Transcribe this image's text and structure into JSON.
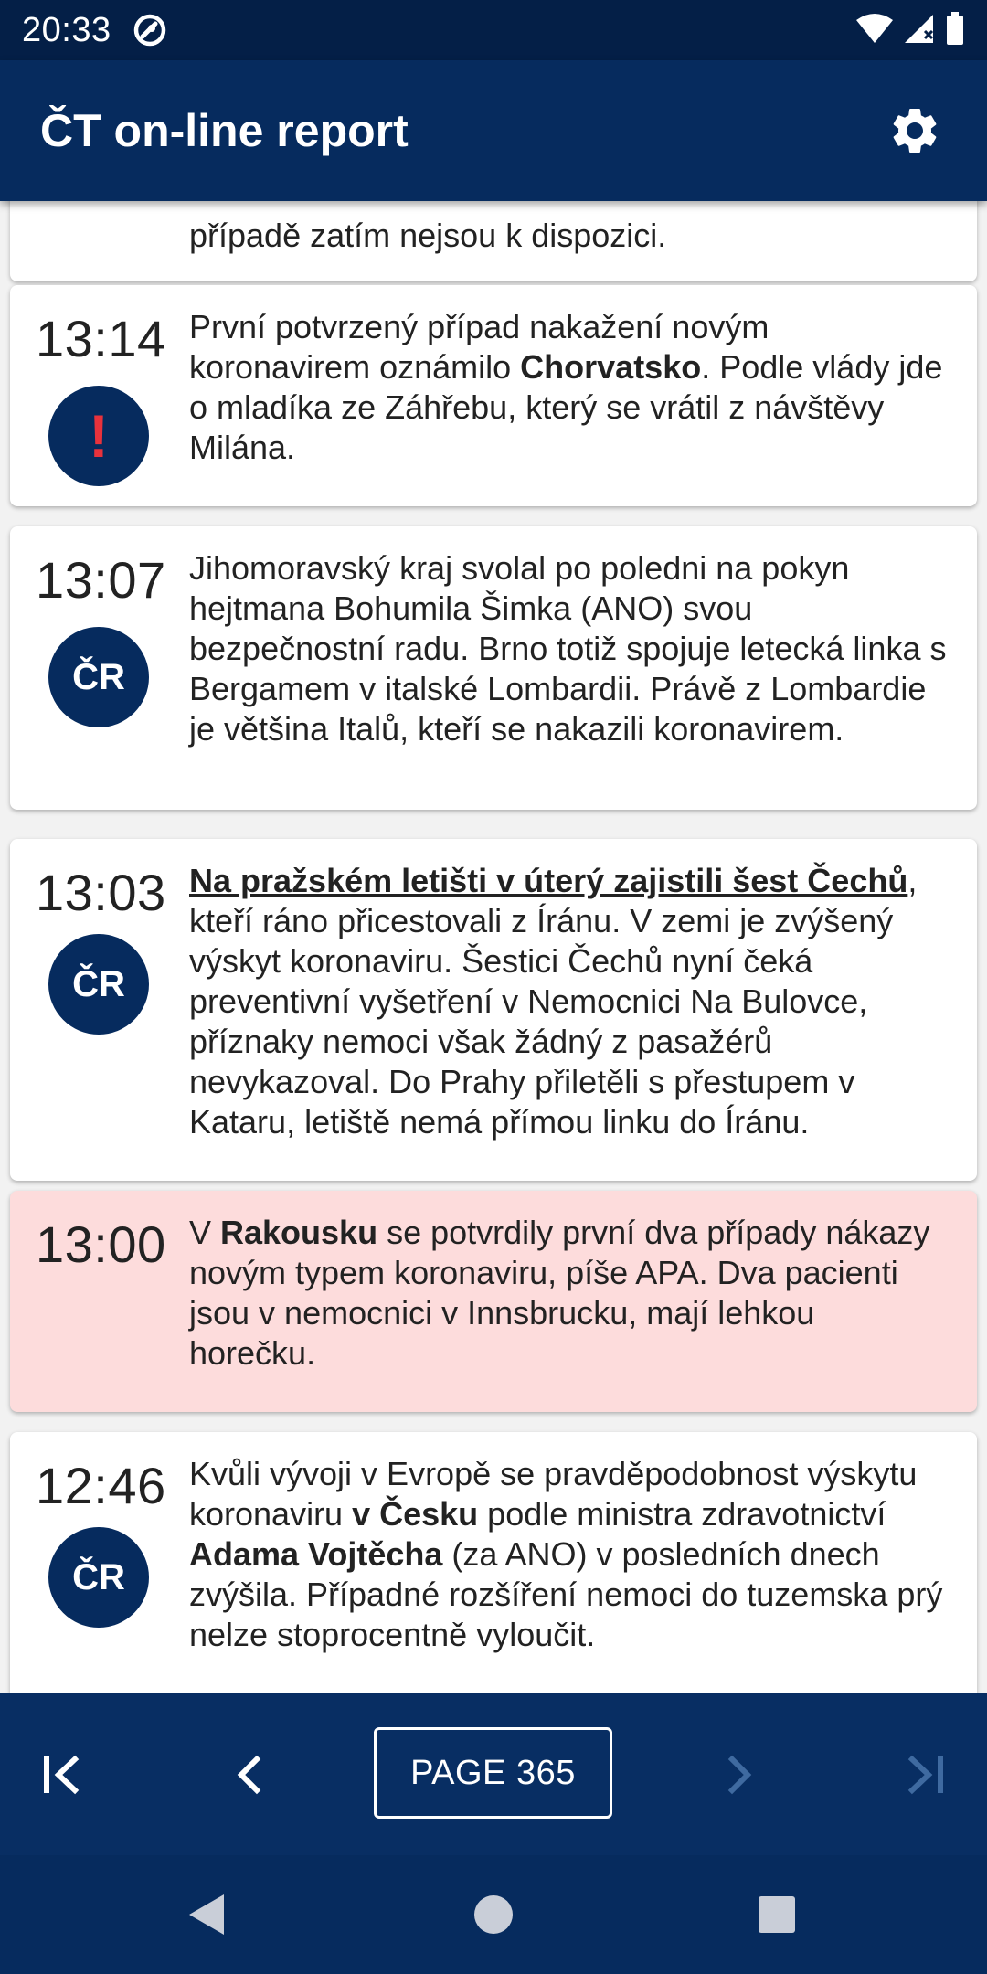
{
  "status_bar": {
    "time": "20:33",
    "icons": [
      "app-notification-icon",
      "wifi-icon",
      "cellular-signal-icon",
      "battery-icon"
    ]
  },
  "app_bar": {
    "title": "ČT on-line report",
    "settings_icon": "gear-icon"
  },
  "partial_card": {
    "text": "případě zatím nejsou k dispozici."
  },
  "feed": [
    {
      "time": "13:14",
      "badge": "!",
      "badge_type": "alert",
      "highlight": false,
      "segments": [
        {
          "t": "První potvrzený případ nakažení novým koronavirem oznámilo ",
          "s": ""
        },
        {
          "t": "Chorvatsko",
          "s": "bold"
        },
        {
          "t": ". Podle vlády jde o mladíka ze Záhřebu, který se vrátil z návštěvy Milána.",
          "s": ""
        }
      ]
    },
    {
      "time": "13:07",
      "badge": "ČR",
      "badge_type": "region",
      "highlight": false,
      "segments": [
        {
          "t": "Jihomoravský kraj svolal po poledni na pokyn hejtmana Bohumila Šimka (ANO) svou bezpečnostní radu. Brno totiž spojuje letecká linka s Bergamem v italské Lombardii. Právě z Lombardie je většina Italů, kteří se nakazili koronavirem.",
          "s": ""
        }
      ]
    },
    {
      "time": "13:03",
      "badge": "ČR",
      "badge_type": "region",
      "highlight": false,
      "segments": [
        {
          "t": "Na pražském letišti v úterý zajistili šest Čechů",
          "s": "link"
        },
        {
          "t": ", kteří ráno přicestovali z Íránu. V zemi je zvýšený výskyt koronaviru. Šestici Čechů nyní čeká preventivní vyšetření v Nemocnici Na Bulovce, příznaky nemoci však žádný z pasažérů nevykazoval. Do Prahy přiletěli s přestupem v Kataru, letiště nemá přímou linku do Íránu.",
          "s": ""
        }
      ]
    },
    {
      "time": "13:00",
      "badge": "",
      "badge_type": "none",
      "highlight": true,
      "segments": [
        {
          "t": "V ",
          "s": ""
        },
        {
          "t": "Rakousku",
          "s": "bold"
        },
        {
          "t": " se potvrdily první dva případy nákazy novým typem koronaviru, píše APA. Dva pacienti jsou v nemocnici v Innsbrucku, mají lehkou horečku.",
          "s": ""
        }
      ]
    },
    {
      "time": "12:46",
      "badge": "ČR",
      "badge_type": "region",
      "highlight": false,
      "segments": [
        {
          "t": "Kvůli vývoji v Evropě se pravděpodobnost výskytu koronaviru ",
          "s": ""
        },
        {
          "t": "v Česku",
          "s": "bold"
        },
        {
          "t": " podle ministra zdravotnictví ",
          "s": ""
        },
        {
          "t": "Adama Vojtěcha",
          "s": "bold"
        },
        {
          "t": " (za ANO) v posledních dnech zvýšila. Případné rozšíření nemoci do tuzemska prý nelze stoprocentně vyloučit.",
          "s": ""
        }
      ]
    }
  ],
  "pager": {
    "first_icon": "first-page-icon",
    "prev_icon": "chevron-left-icon",
    "page_label": "PAGE 365",
    "next_icon": "chevron-right-icon",
    "last_icon": "last-page-icon"
  },
  "nav_bar": {
    "back_icon": "back-triangle-icon",
    "home_icon": "home-circle-icon",
    "recents_icon": "recents-square-icon"
  },
  "colors": {
    "brand_navy": "#062b5e",
    "pager_navy": "#082e63",
    "alert_red": "#e8323c",
    "highlight_bg": "#fddcdc",
    "feed_bg": "#f2f2f2",
    "card_bg": "#ffffff"
  }
}
